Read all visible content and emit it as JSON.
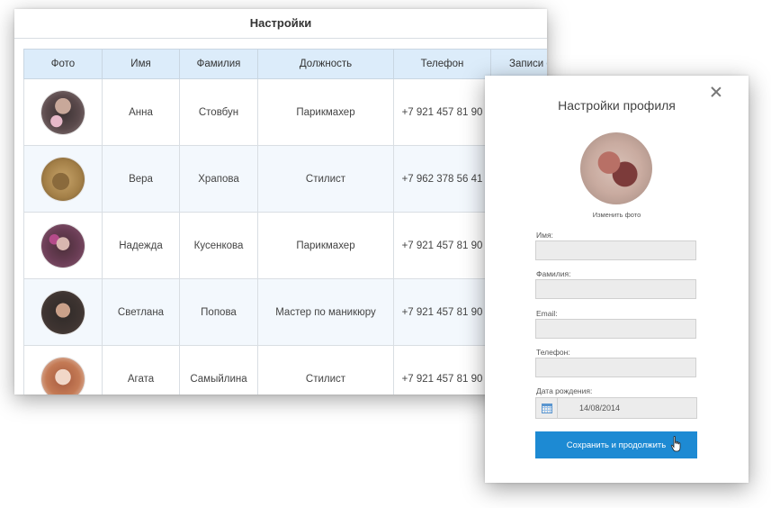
{
  "settings": {
    "title": "Настройки",
    "columns": [
      "Фото",
      "Имя",
      "Фамилия",
      "Должность",
      "Телефон",
      "Записи о"
    ],
    "rows": [
      {
        "first_name": "Анна",
        "last_name": "Стовбун",
        "position": "Парикмахер",
        "phone": "+7 921 457 81 90"
      },
      {
        "first_name": "Вера",
        "last_name": "Храпова",
        "position": "Стилист",
        "phone": "+7 962 378 56 41"
      },
      {
        "first_name": "Надежда",
        "last_name": "Кусенкова",
        "position": "Парикмахер",
        "phone": "+7 921 457 81 90"
      },
      {
        "first_name": "Светлана",
        "last_name": "Попова",
        "position": "Мастер по маникюру",
        "phone": "+7 921 457 81 90"
      },
      {
        "first_name": "Агата",
        "last_name": "Самыйлина",
        "position": "Стилист",
        "phone": "+7 921 457 81 90"
      }
    ]
  },
  "profile": {
    "title": "Настройки профиля",
    "change_photo": "Изменить фото",
    "labels": {
      "first_name": "Имя:",
      "last_name": "Фамилия:",
      "email": "Email:",
      "phone": "Телефон:",
      "birth_date": "Дата рождения:"
    },
    "birth_date_value": "14/08/2014",
    "save_button": "Сохранить и продолжить"
  },
  "colors": {
    "header_bg": "#dcecfa",
    "accent": "#1d8ad3",
    "alt_row": "#f3f8fd"
  },
  "icons": [
    "close-icon",
    "calendar-icon",
    "hand-cursor-icon"
  ]
}
